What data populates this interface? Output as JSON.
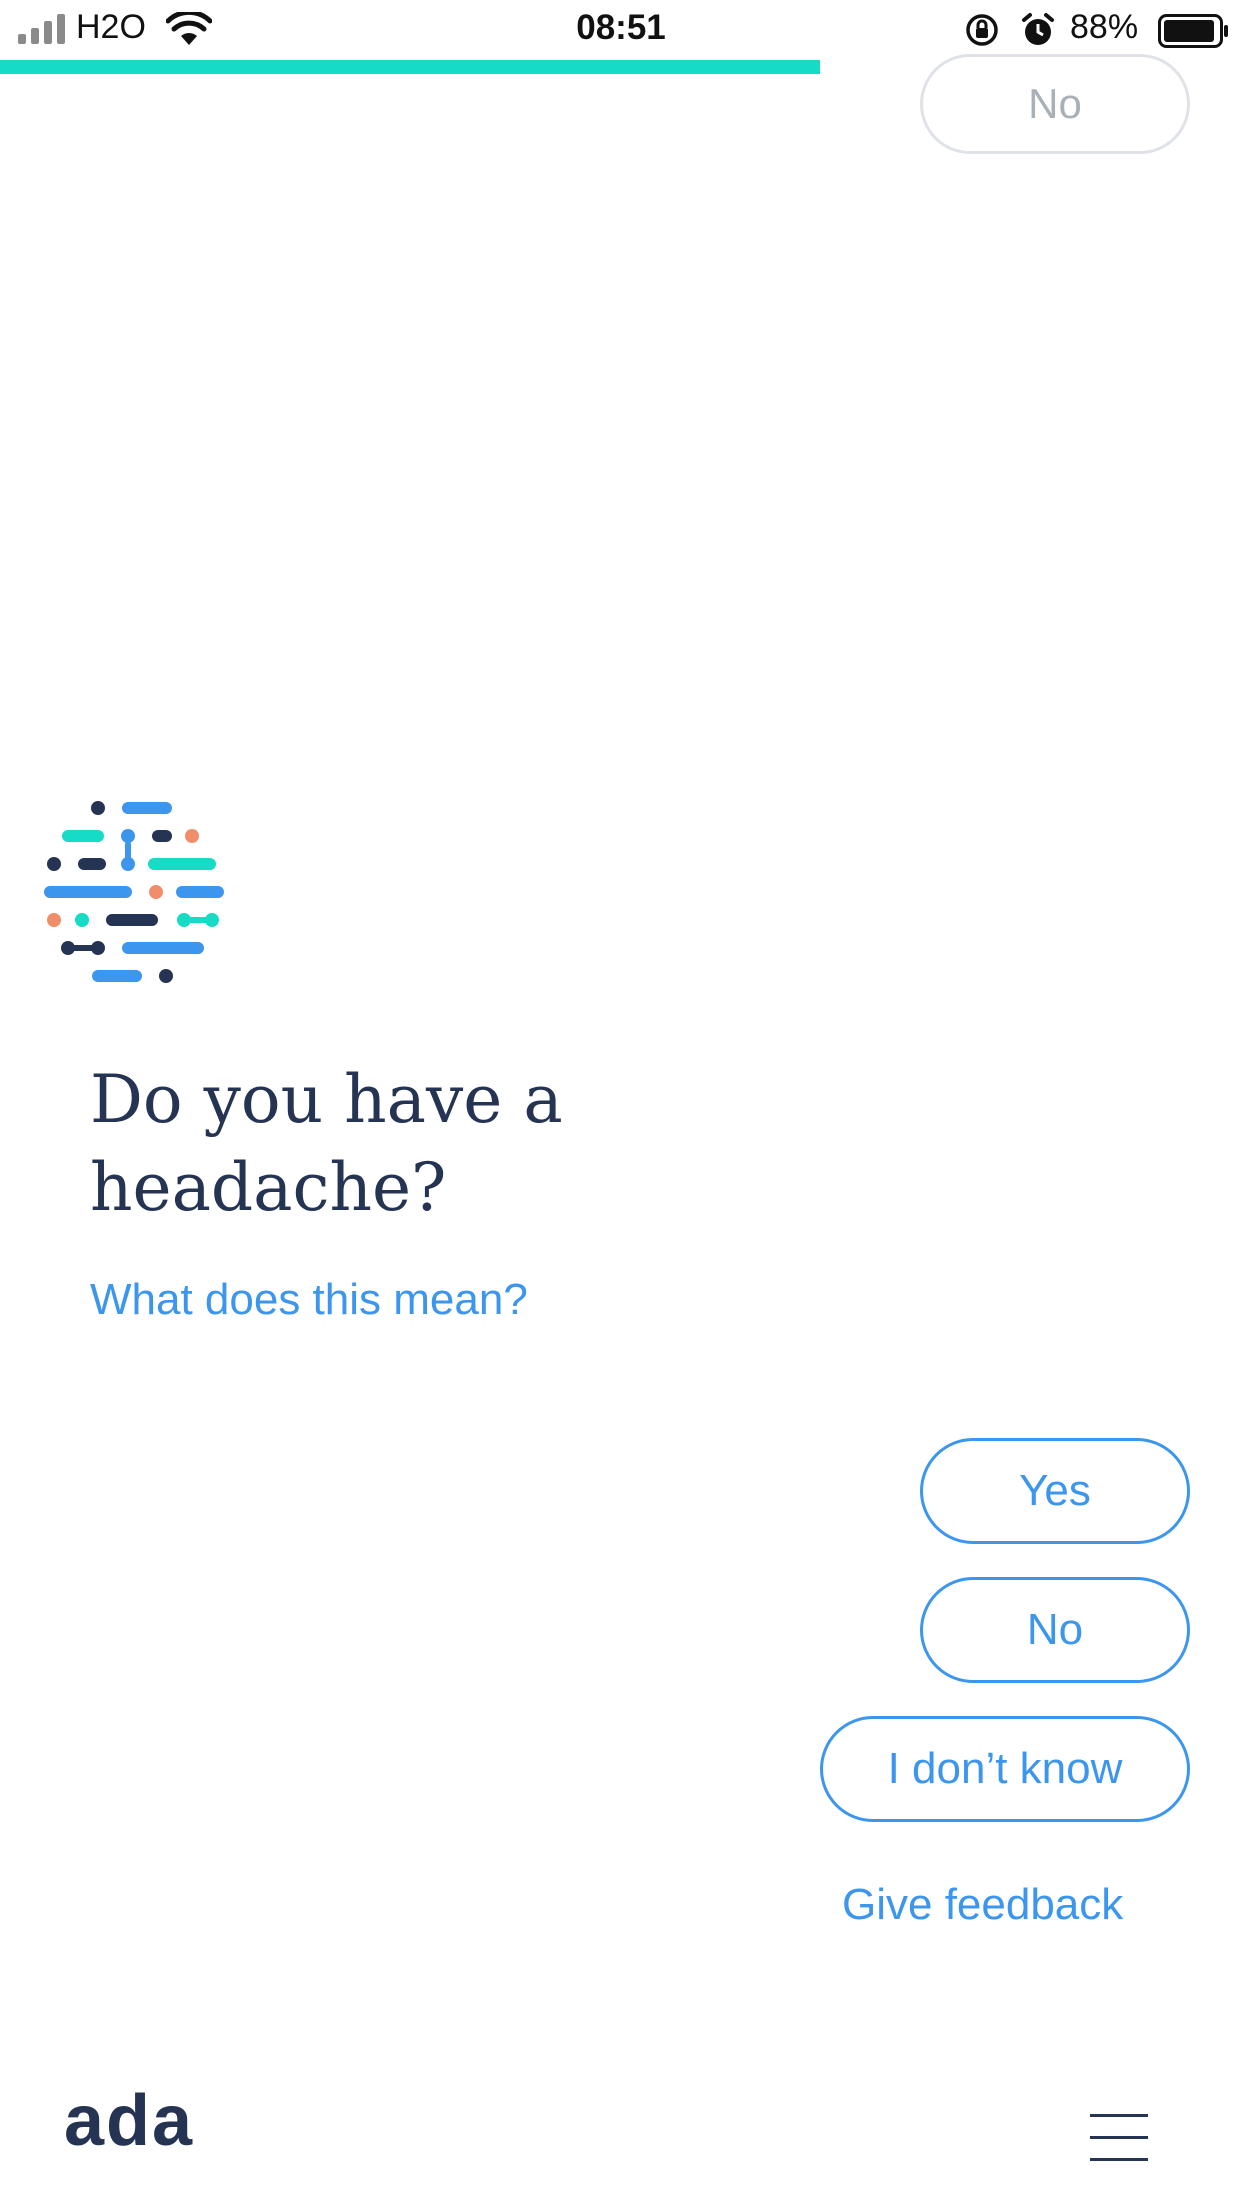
{
  "status_bar": {
    "carrier": "H2O",
    "time": "08:51",
    "battery_percent": "88%",
    "icons": [
      "signal-icon",
      "wifi-icon",
      "rotation-lock-icon",
      "alarm-icon",
      "battery-icon"
    ]
  },
  "progress": {
    "value": 0.66,
    "color": "#16dcc6"
  },
  "previous_answer": {
    "label": "No"
  },
  "question": {
    "title": "Do you have a headache?",
    "help_link": "What does this mean?"
  },
  "answers": [
    {
      "label": "Yes"
    },
    {
      "label": "No"
    },
    {
      "label": "I don’t know"
    }
  ],
  "feedback_link": "Give feedback",
  "footer": {
    "brand": "ada",
    "menu_icon": "hamburger-menu-icon"
  },
  "colors": {
    "accent": "#3d96ee",
    "navy": "#263454",
    "teal": "#16dcc6",
    "coral": "#f28d6b"
  }
}
